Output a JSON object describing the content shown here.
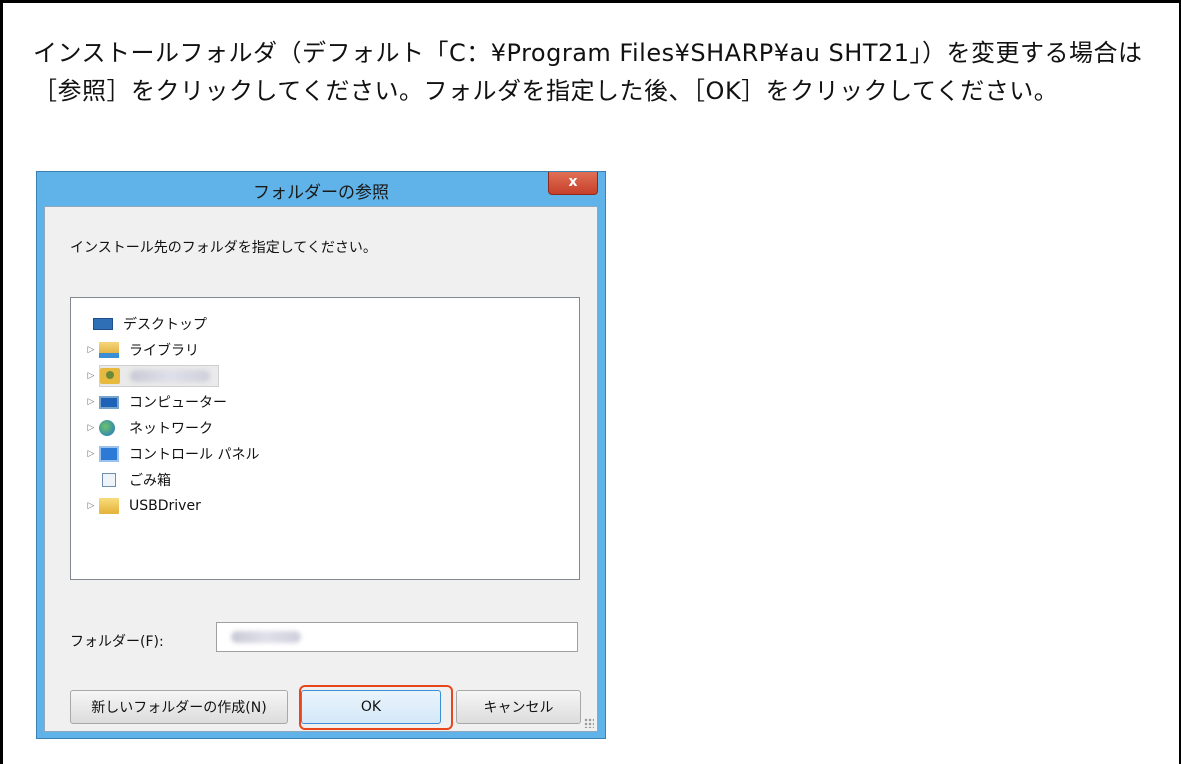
{
  "instruction": {
    "text": "インストールフォルダ（デフォルト「C：¥Program Files¥SHARP¥au SHT21」）を変更する場合は［参照］をクリックしてください。フォルダを指定した後、［OK］をクリックしてください。"
  },
  "dialog": {
    "title": "フォルダーの参照",
    "close_label": "x",
    "prompt": "インストール先のフォルダを指定してください。",
    "tree": [
      {
        "label": "デスクトップ",
        "icon": "desktop-icon",
        "expandable": false
      },
      {
        "label": "ライブラリ",
        "icon": "library-icon",
        "expandable": true
      },
      {
        "label": "",
        "icon": "user-folder-icon",
        "expandable": true,
        "redacted": true,
        "selected": true
      },
      {
        "label": "コンピューター",
        "icon": "computer-icon",
        "expandable": true
      },
      {
        "label": "ネットワーク",
        "icon": "network-icon",
        "expandable": true
      },
      {
        "label": "コントロール パネル",
        "icon": "control-panel-icon",
        "expandable": true
      },
      {
        "label": "ごみ箱",
        "icon": "recycle-bin-icon",
        "expandable": false
      },
      {
        "label": "USBDriver",
        "icon": "folder-icon",
        "expandable": true
      }
    ],
    "folder_label": "フォルダー(F):",
    "folder_value": "",
    "buttons": {
      "new_folder": "新しいフォルダーの作成(N)",
      "ok": "OK",
      "cancel": "キャンセル"
    }
  },
  "colors": {
    "window_frame": "#5fb3e8",
    "close_button": "#c7402b",
    "highlight": "#e8471c"
  }
}
